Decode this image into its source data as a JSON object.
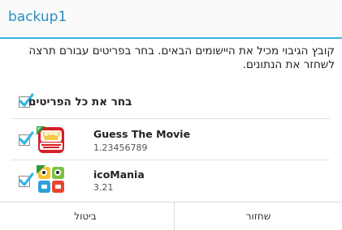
{
  "dialog": {
    "title": "backup1",
    "message": "קובץ הגיבוי מכיל את היישומים הבאים. בחר בפריטים עבורם תרצה לשחזר את הנתונים.",
    "select_all_label": "בחר את כל הפריטים",
    "select_all_checked": true,
    "items": [
      {
        "name": "Guess The Movie",
        "version": "1.23456789",
        "checked": true,
        "icon": "guess-the-movie-app-icon"
      },
      {
        "name": "icoMania",
        "version": "3.21",
        "checked": true,
        "icon": "icomania-app-icon"
      }
    ],
    "buttons": {
      "cancel": "ביטול",
      "restore": "שחזור"
    }
  },
  "colors": {
    "accent": "#33b5e5",
    "title_text": "#2a8ec2",
    "check": "#33b5e5"
  }
}
